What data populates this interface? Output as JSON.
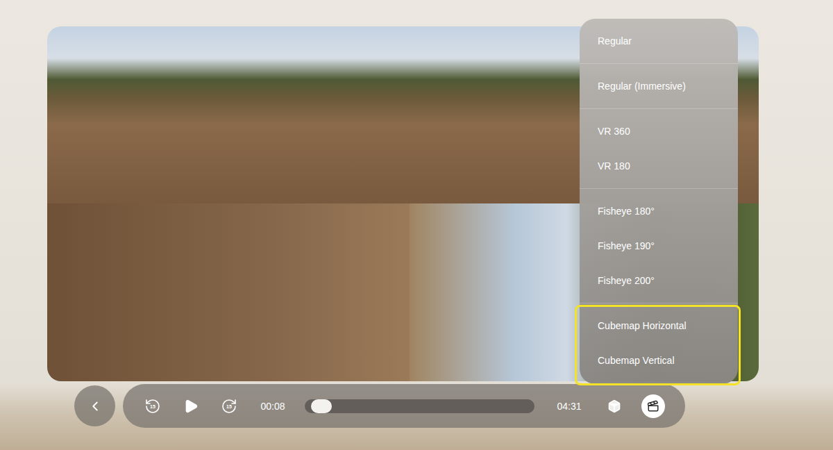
{
  "menu": {
    "groups": [
      {
        "items": [
          "Regular"
        ],
        "highlighted": false
      },
      {
        "items": [
          "Regular (Immersive)"
        ],
        "highlighted": false
      },
      {
        "items": [
          "VR 360",
          "VR 180"
        ],
        "highlighted": false
      },
      {
        "items": [
          "Fisheye 180°",
          "Fisheye 190°",
          "Fisheye 200°"
        ],
        "highlighted": false
      },
      {
        "items": [
          "Cubemap Horizontal",
          "Cubemap Vertical"
        ],
        "highlighted": true
      }
    ]
  },
  "player": {
    "skip_back": "15",
    "skip_forward": "15",
    "playing": false,
    "elapsed": "00:08",
    "level": 0.03,
    "duration": "04:31",
    "view_mode_active": true
  }
}
